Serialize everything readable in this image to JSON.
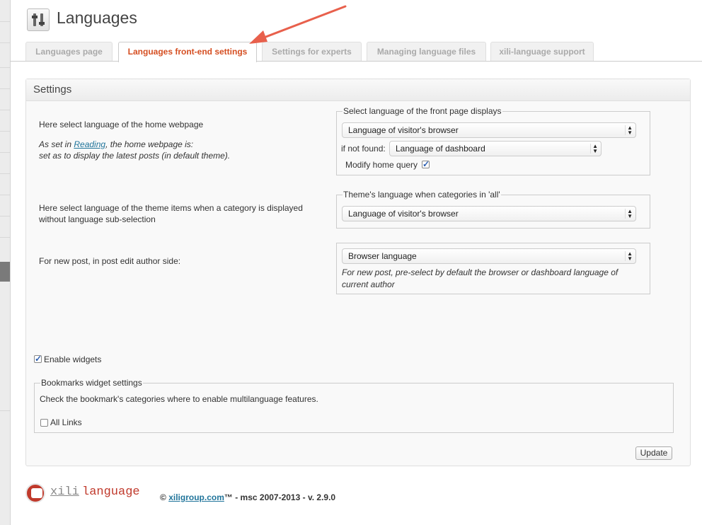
{
  "page": {
    "title": "Languages"
  },
  "tabs": [
    {
      "label": "Languages page"
    },
    {
      "label": "Languages front-end settings"
    },
    {
      "label": "Settings for experts"
    },
    {
      "label": "Managing language files"
    },
    {
      "label": "xili-language support"
    }
  ],
  "settings": {
    "heading": "Settings",
    "home": {
      "description": "Here select language of the home webpage",
      "note_prefix": "As set in ",
      "note_link": "Reading",
      "note_suffix": ", the home webpage is:",
      "note_line2": "set as to display the latest posts (in default theme).",
      "fieldset_legend": "Select language of the front page displays",
      "select_value": "Language of visitor's browser",
      "not_found_label": "if not found:",
      "not_found_value": "Language of dashboard",
      "modify_label": "Modify home query",
      "modify_checked": true
    },
    "theme": {
      "description_line1": "Here select language of the theme items when a category is displayed",
      "description_line2": "without language sub-selection",
      "fieldset_legend": "Theme's language when categories in 'all'",
      "select_value": "Language of visitor's browser"
    },
    "new_post": {
      "description": "For new post, in post edit author side:",
      "select_value": "Browser language",
      "help_line1": "For new post, pre-select by default the browser or dashboard language of",
      "help_line2": "current author"
    },
    "widgets": {
      "enable_label": "Enable widgets",
      "enable_checked": true,
      "bookmarks_legend": "Bookmarks widget settings",
      "bookmarks_help": "Check the bookmark's categories where to enable multilanguage features.",
      "all_links_label": "All Links",
      "all_links_checked": false
    },
    "update_label": "Update"
  },
  "footer": {
    "brand_part1": "xili",
    "brand_part2": "language",
    "copyright_symbol": "© ",
    "link": "xiligroup.com",
    "rest": "™ - msc 2007-2013 - v. 2.9.0"
  },
  "colors": {
    "active_tab": "#d54e21",
    "link": "#21759b",
    "arrow": "#e8604c",
    "brand_red": "#c0392b"
  },
  "icons": {
    "page": "settings-sliders-icon",
    "checkmark": "check-icon"
  }
}
